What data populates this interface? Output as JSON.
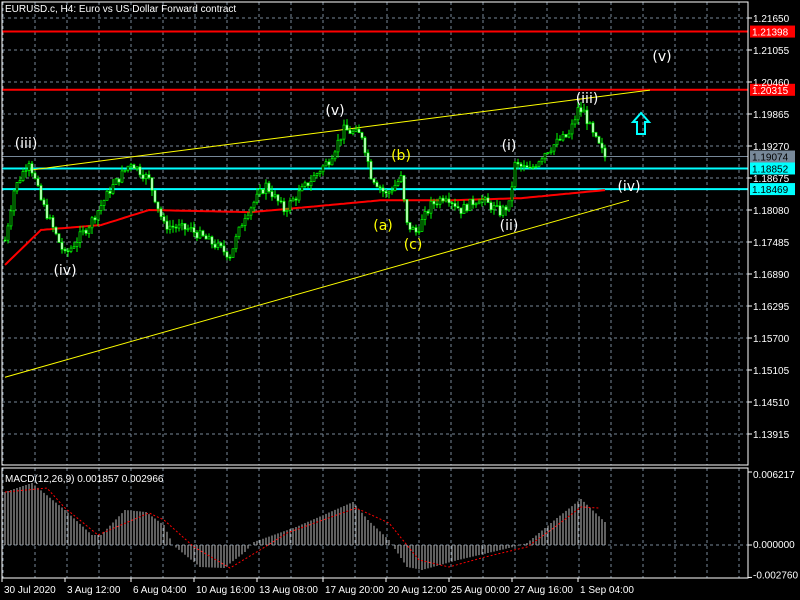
{
  "window": {
    "title": "EURUSD.c, H4:  Euro vs US Dollar Forward contract"
  },
  "colors": {
    "background": "#000000",
    "grid": "#778899",
    "bull_fill": "#000000",
    "bear_fill": "#ffffff",
    "candle_outline": "#00ff00",
    "ma": "#ff0000",
    "trendline": "#ffff00",
    "red_level": "#ff0000",
    "cyan_level": "#00ffff",
    "bid_level": "#778899",
    "wave_white": "#ffffff",
    "wave_yellow": "#ffff00",
    "arrow": "#00ffff",
    "macd_hist": "#c0c0c0",
    "macd_signal": "#ff0000"
  },
  "chart_data": {
    "type": "candlestick",
    "symbol": "EURUSD.c",
    "timeframe": "H4",
    "ylim": [
      1.13575,
      1.2192
    ],
    "bars": 201,
    "price_ticks": [
      "1.21650",
      "1.21055",
      "1.20460",
      "1.19865",
      "1.19270",
      "1.18675",
      "1.18080",
      "1.17485",
      "1.16890",
      "1.16295",
      "1.15700",
      "1.15105",
      "1.14510",
      "1.13915"
    ],
    "time_labels": [
      {
        "bar": 0,
        "label": "30 Jul 2020"
      },
      {
        "bar": 20,
        "label": "3 Aug 12:00"
      },
      {
        "bar": 42,
        "label": "6 Aug 04:00"
      },
      {
        "bar": 63,
        "label": "10 Aug 16:00"
      },
      {
        "bar": 84,
        "label": "13 Aug 08:00"
      },
      {
        "bar": 106,
        "label": "17 Aug 20:00"
      },
      {
        "bar": 127,
        "label": "20 Aug 12:00"
      },
      {
        "bar": 148,
        "label": "25 Aug 00:00"
      },
      {
        "bar": 169,
        "label": "27 Aug 16:00"
      },
      {
        "bar": 191,
        "label": "1 Sep 04:00"
      }
    ],
    "price_path": [
      [
        0,
        1.1752
      ],
      [
        3,
        1.1845
      ],
      [
        8,
        1.1901
      ],
      [
        12,
        1.1826
      ],
      [
        17,
        1.1761
      ],
      [
        20,
        1.1724
      ],
      [
        28,
        1.178
      ],
      [
        35,
        1.1845
      ],
      [
        42,
        1.1897
      ],
      [
        48,
        1.1864
      ],
      [
        53,
        1.178
      ],
      [
        62,
        1.1771
      ],
      [
        70,
        1.1743
      ],
      [
        75,
        1.1724
      ],
      [
        80,
        1.1799
      ],
      [
        87,
        1.1854
      ],
      [
        93,
        1.1808
      ],
      [
        102,
        1.1864
      ],
      [
        108,
        1.1901
      ],
      [
        113,
        1.1957
      ],
      [
        119,
        1.1947
      ],
      [
        122,
        1.1873
      ],
      [
        127,
        1.1836
      ],
      [
        132,
        1.1867
      ],
      [
        134,
        1.178
      ],
      [
        137,
        1.1767
      ],
      [
        142,
        1.1817
      ],
      [
        147,
        1.1836
      ],
      [
        152,
        1.1808
      ],
      [
        158,
        1.183
      ],
      [
        165,
        1.1804
      ],
      [
        168,
        1.1817
      ],
      [
        170,
        1.1892
      ],
      [
        175,
        1.1882
      ],
      [
        180,
        1.1916
      ],
      [
        185,
        1.1938
      ],
      [
        188,
        1.1947
      ],
      [
        191,
        1.1994
      ],
      [
        193,
        1.199
      ],
      [
        196,
        1.1947
      ],
      [
        200,
        1.1907
      ]
    ],
    "moving_average": [
      [
        0,
        1.1706
      ],
      [
        12,
        1.1771
      ],
      [
        32,
        1.178
      ],
      [
        48,
        1.1808
      ],
      [
        82,
        1.1804
      ],
      [
        98,
        1.1812
      ],
      [
        125,
        1.1826
      ],
      [
        148,
        1.1826
      ],
      [
        172,
        1.183
      ],
      [
        200,
        1.1845
      ]
    ],
    "levels": [
      {
        "price": 1.21398,
        "label": "1.21398",
        "kind": "red"
      },
      {
        "price": 1.20315,
        "label": "1.20315",
        "kind": "red"
      },
      {
        "price": 1.19074,
        "label": "1.19074",
        "kind": "bid"
      },
      {
        "price": 1.18852,
        "label": "1.18852",
        "kind": "cyan"
      },
      {
        "price": 1.18469,
        "label": "1.18469",
        "kind": "cyan"
      }
    ],
    "trendlines": [
      {
        "from": [
          8,
          1.1882
        ],
        "to": [
          215,
          1.2031
        ]
      },
      {
        "from": [
          0,
          1.1497
        ],
        "to": [
          208,
          1.1826
        ]
      }
    ],
    "wave_labels": [
      {
        "text": "(iii)",
        "bar": 7,
        "price": 1.1933,
        "color": "white"
      },
      {
        "text": "(iv)",
        "bar": 20,
        "price": 1.1696,
        "color": "white"
      },
      {
        "text": "(v)",
        "bar": 110,
        "price": 1.1994,
        "color": "white"
      },
      {
        "text": "(b)",
        "bar": 132,
        "price": 1.191,
        "color": "yellow"
      },
      {
        "text": "(a)",
        "bar": 126,
        "price": 1.178,
        "color": "yellow"
      },
      {
        "text": "(c)",
        "bar": 136,
        "price": 1.1745,
        "color": "yellow"
      },
      {
        "text": "(i)",
        "bar": 168,
        "price": 1.1929,
        "color": "white"
      },
      {
        "text": "(ii)",
        "bar": 168,
        "price": 1.178,
        "color": "white"
      },
      {
        "text": "(iii)",
        "bar": 194,
        "price": 1.2016,
        "color": "white"
      },
      {
        "text": "(iv)",
        "bar": 208,
        "price": 1.1853,
        "color": "white"
      },
      {
        "text": "(v)",
        "bar": 219,
        "price": 1.2094,
        "color": "white"
      }
    ],
    "up_arrow": {
      "bar": 212,
      "price": 1.1968
    },
    "macd": {
      "label": "MACD(12,26,9) 0.001857 0.002966",
      "ylim": [
        -0.00276,
        0.006217
      ],
      "ticks": [
        "0.006217",
        "0.000000",
        "-0.002760"
      ],
      "histogram": [
        [
          0,
          0.00451
        ],
        [
          9,
          0.00528
        ],
        [
          20,
          0.00298
        ],
        [
          29,
          0.00085
        ],
        [
          32,
          0.00085
        ],
        [
          40,
          0.00298
        ],
        [
          47,
          0.00281
        ],
        [
          53,
          0.0017
        ],
        [
          56,
          0
        ],
        [
          65,
          -0.00187
        ],
        [
          73,
          -0.00196
        ],
        [
          80,
          -0.0006
        ],
        [
          83,
          0.00026
        ],
        [
          97,
          0.00153
        ],
        [
          116,
          0.00366
        ],
        [
          121,
          0.00213
        ],
        [
          128,
          0.00043
        ],
        [
          134,
          -0.00187
        ],
        [
          139,
          -0.00213
        ],
        [
          151,
          -0.00128
        ],
        [
          168,
          -0.00026
        ],
        [
          174,
          0.00017
        ],
        [
          184,
          0.0023
        ],
        [
          192,
          0.00392
        ],
        [
          200,
          0.00196
        ]
      ],
      "signal": [
        [
          0,
          0.00451
        ],
        [
          14,
          0.00485
        ],
        [
          20,
          0.00315
        ],
        [
          31,
          0.00085
        ],
        [
          48,
          0.00273
        ],
        [
          53,
          0.00213
        ],
        [
          63,
          -0.00017
        ],
        [
          75,
          -0.00196
        ],
        [
          85,
          -0.00043
        ],
        [
          94,
          0.00102
        ],
        [
          117,
          0.00315
        ],
        [
          128,
          0.00187
        ],
        [
          138,
          -0.00128
        ],
        [
          148,
          -0.00187
        ],
        [
          160,
          -0.00102
        ],
        [
          174,
          -0.00017
        ],
        [
          182,
          0.00128
        ],
        [
          192,
          0.00324
        ],
        [
          198,
          0.00315
        ]
      ]
    }
  }
}
